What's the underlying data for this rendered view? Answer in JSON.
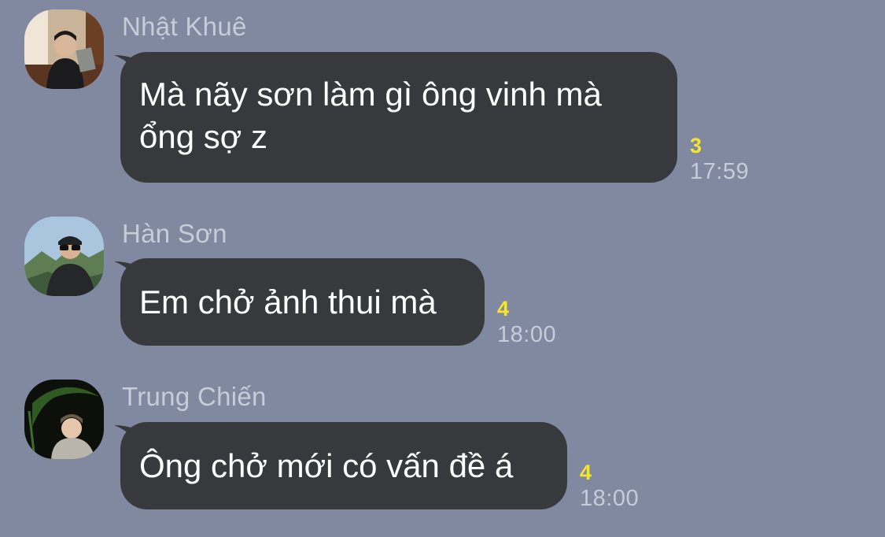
{
  "messages": [
    {
      "sender": "Nhật Khuê",
      "avatar_icon": "profile-photo-reading-book",
      "text_lines": [
        "Mà nãy sơn làm gì ông vinh mà",
        "ổng sợ z"
      ],
      "read_count": "3",
      "time": "17:59"
    },
    {
      "sender": "Hàn Sơn",
      "avatar_icon": "profile-photo-sunglasses-mountains",
      "text_lines": [
        "Em chở ảnh thui mà"
      ],
      "read_count": "4",
      "time": "18:00"
    },
    {
      "sender": "Trung Chiến",
      "avatar_icon": "profile-photo-dark-leaf",
      "text_lines": [
        "Ông chở mới có vấn đề á"
      ],
      "read_count": "4",
      "time": "18:00"
    }
  ],
  "colors": {
    "background": "#8089a0",
    "bubble": "#38393c",
    "read_count": "#f5e62b",
    "muted_text": "#c6ccd8"
  }
}
